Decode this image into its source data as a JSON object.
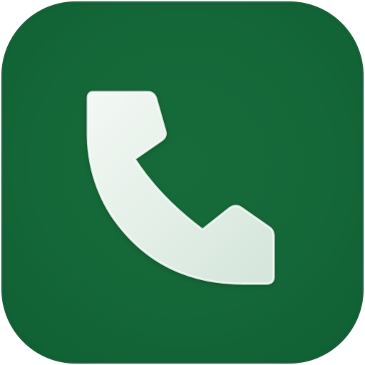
{
  "app_icon": {
    "icon": "phone-icon",
    "background_color": "#146738",
    "glyph_color": "#e3efe8"
  }
}
